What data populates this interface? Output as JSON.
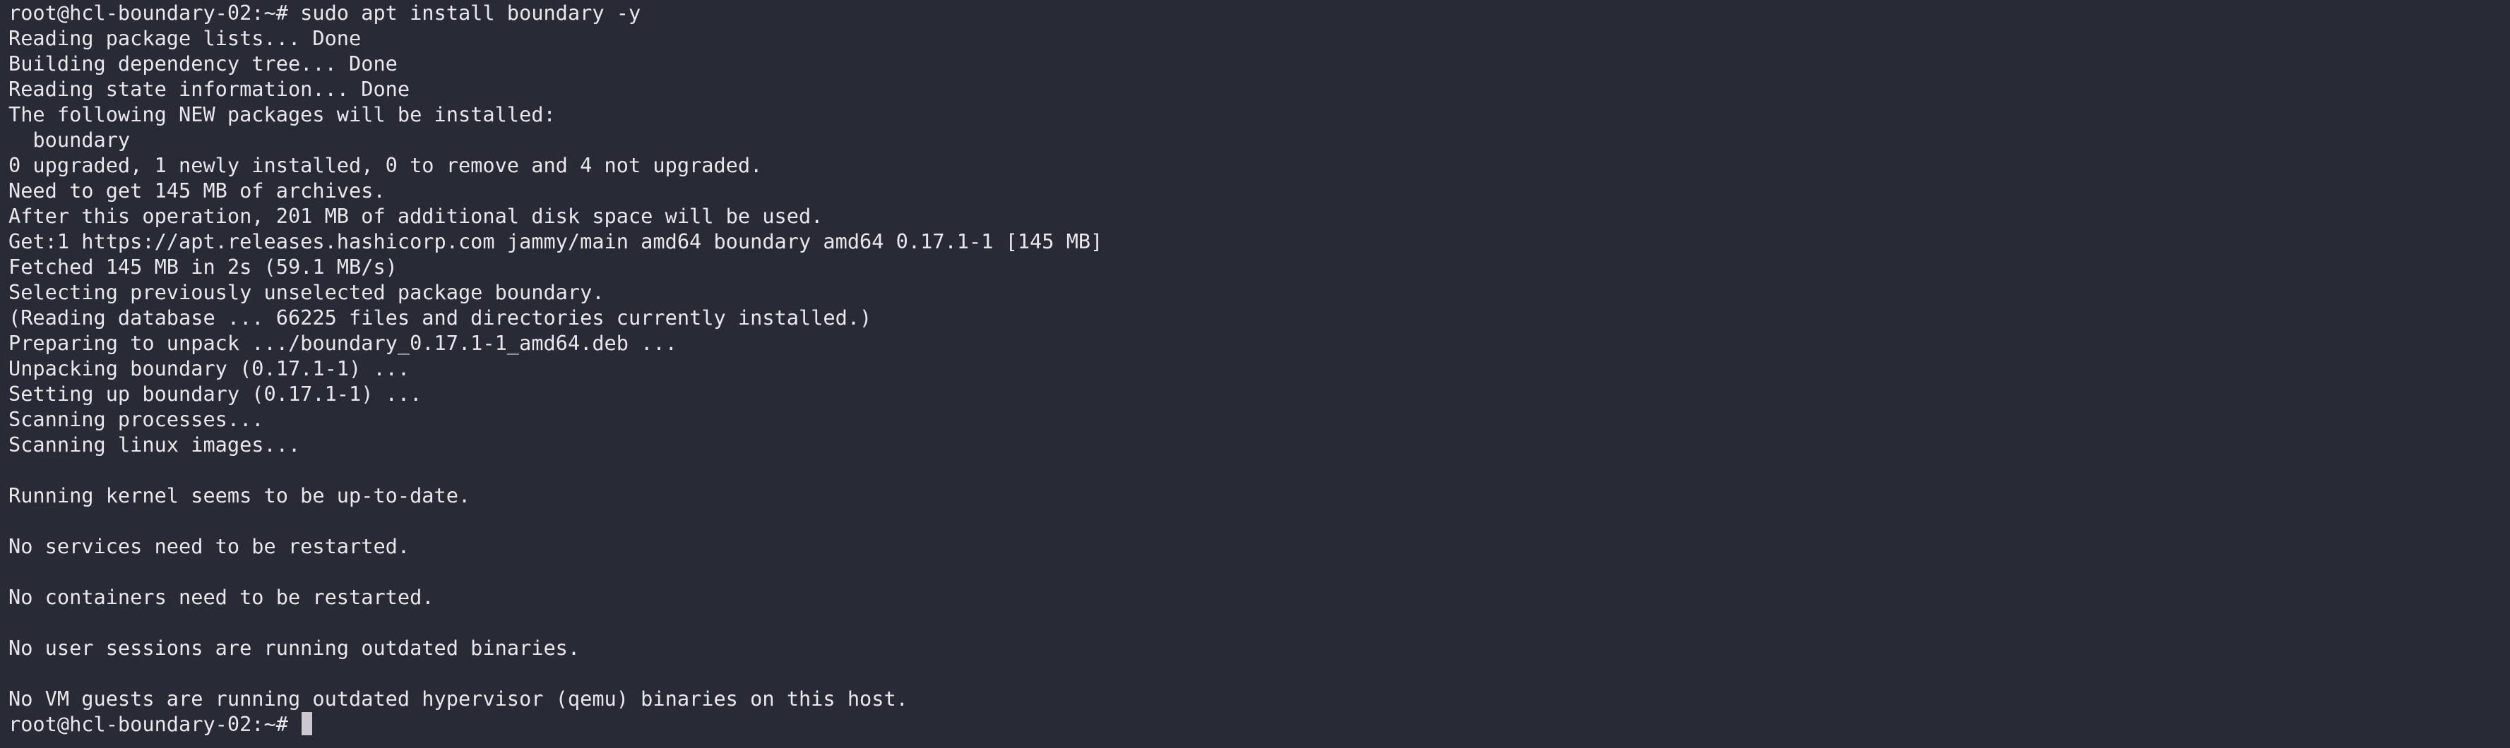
{
  "colors": {
    "background": "#282b36",
    "foreground": "#e8e8ec",
    "cursor": "#c9c9cf"
  },
  "terminal": {
    "lines": [
      "root@hcl-boundary-02:~# sudo apt install boundary -y",
      "Reading package lists... Done",
      "Building dependency tree... Done",
      "Reading state information... Done",
      "The following NEW packages will be installed:",
      "  boundary",
      "0 upgraded, 1 newly installed, 0 to remove and 4 not upgraded.",
      "Need to get 145 MB of archives.",
      "After this operation, 201 MB of additional disk space will be used.",
      "Get:1 https://apt.releases.hashicorp.com jammy/main amd64 boundary amd64 0.17.1-1 [145 MB]",
      "Fetched 145 MB in 2s (59.1 MB/s)",
      "Selecting previously unselected package boundary.",
      "(Reading database ... 66225 files and directories currently installed.)",
      "Preparing to unpack .../boundary_0.17.1-1_amd64.deb ...",
      "Unpacking boundary (0.17.1-1) ...",
      "Setting up boundary (0.17.1-1) ...",
      "Scanning processes...",
      "Scanning linux images...",
      "",
      "Running kernel seems to be up-to-date.",
      "",
      "No services need to be restarted.",
      "",
      "No containers need to be restarted.",
      "",
      "No user sessions are running outdated binaries.",
      "",
      "No VM guests are running outdated hypervisor (qemu) binaries on this host."
    ],
    "prompt": "root@hcl-boundary-02:~# "
  }
}
